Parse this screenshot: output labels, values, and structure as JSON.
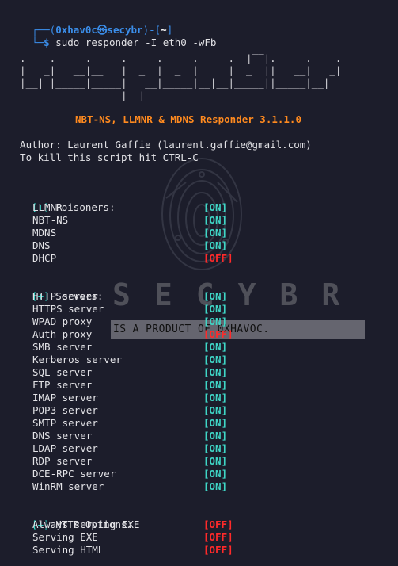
{
  "prompt": {
    "corner_top": "┌──(",
    "user": "0xhav0c",
    "at_symbol": "㉿",
    "host": "secybr",
    "mid": ")-[",
    "dir": "~",
    "close": "]",
    "corner_bottom": "└─",
    "dollar": "$",
    "command": " sudo responder -I eth0 -wFb"
  },
  "banner": {
    "ascii": [
      "                                         __",
      "  .----.-----.-----.-----.-----.-----.--|  |.-----.----.",
      "  |   _|  -__|__ --|  _  |  _  |     |  _  ||  -__|   _|",
      "  |__| |_____|_____|   __|_____|__|__|_____||_____|__|",
      "                   |__|"
    ],
    "title": "NBT-NS, LLMNR & MDNS Responder 3.1.1.0",
    "author": "  Author: Laurent Gaffie (laurent.gaffie@gmail.com)",
    "kill": "  To kill this script hit CTRL-C"
  },
  "sections": {
    "poisoners": {
      "tag": "[+]",
      "title": " Poisoners:",
      "items": [
        {
          "label": "LLMNR",
          "status": "[ON]"
        },
        {
          "label": "NBT-NS",
          "status": "[ON]"
        },
        {
          "label": "MDNS",
          "status": "[ON]"
        },
        {
          "label": "DNS",
          "status": "[ON]"
        },
        {
          "label": "DHCP",
          "status": "[OFF]"
        }
      ]
    },
    "servers": {
      "tag": "[+]",
      "title": " Servers:",
      "items": [
        {
          "label": "HTTP server",
          "status": "[ON]"
        },
        {
          "label": "HTTPS server",
          "status": "[ON]"
        },
        {
          "label": "WPAD proxy",
          "status": "[ON]"
        },
        {
          "label": "Auth proxy",
          "status": "[OFF]"
        },
        {
          "label": "SMB server",
          "status": "[ON]"
        },
        {
          "label": "Kerberos server",
          "status": "[ON]"
        },
        {
          "label": "SQL server",
          "status": "[ON]"
        },
        {
          "label": "FTP server",
          "status": "[ON]"
        },
        {
          "label": "IMAP server",
          "status": "[ON]"
        },
        {
          "label": "POP3 server",
          "status": "[ON]"
        },
        {
          "label": "SMTP server",
          "status": "[ON]"
        },
        {
          "label": "DNS server",
          "status": "[ON]"
        },
        {
          "label": "LDAP server",
          "status": "[ON]"
        },
        {
          "label": "RDP server",
          "status": "[ON]"
        },
        {
          "label": "DCE-RPC server",
          "status": "[ON]"
        },
        {
          "label": "WinRM server",
          "status": "[ON]"
        }
      ]
    },
    "http_options": {
      "tag": "[+]",
      "title": " HTTP Options:",
      "items": [
        {
          "label": "Always serving EXE",
          "status": "[OFF]"
        },
        {
          "label": "Serving EXE",
          "status": "[OFF]"
        },
        {
          "label": "Serving HTML",
          "status": "[OFF]"
        }
      ]
    }
  },
  "watermark": {
    "brand": "SECYBR",
    "tagline": "IS A PRODUCT OF 0XHAVOC."
  },
  "colors": {
    "background": "#1c1d2b",
    "prompt_blue": "#3b8eea",
    "title_orange": "#ff8a1f",
    "on_cyan": "#3fd6c6",
    "off_red": "#ff2a2a"
  }
}
